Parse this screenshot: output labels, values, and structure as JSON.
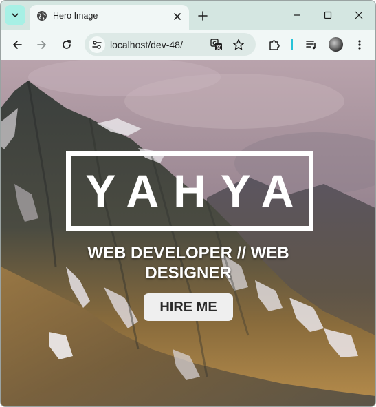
{
  "browser": {
    "tab": {
      "title": "Hero Image",
      "favicon": "globe-icon"
    },
    "address_bar": {
      "url": "localhost/dev-48/"
    },
    "icons": {
      "tab_search": "chevron-down-icon",
      "tab_close": "close-icon",
      "new_tab": "plus-icon",
      "minimize": "minimize-icon",
      "maximize": "maximize-icon",
      "close_window": "close-icon",
      "back": "back-arrow-icon",
      "forward": "forward-arrow-icon",
      "reload": "reload-icon",
      "site_info": "tune-icon",
      "translate": "translate-icon",
      "bookmark": "star-icon",
      "extensions": "puzzle-icon",
      "media": "playlist-icon",
      "profile": "avatar",
      "menu": "kebab-menu-icon"
    },
    "colors": {
      "tabstrip": "#d4e6e1",
      "toolbar": "#f1f7f6",
      "tab_search_accent": "#a7f0e5",
      "divider_accent": "#27c3d8"
    }
  },
  "hero": {
    "logo": "YAHYA",
    "subtitle": "WEB DEVELOPER // WEB DESIGNER",
    "cta_label": "HIRE ME",
    "background": "mountain-landscape-image",
    "colors": {
      "text": "#ffffff",
      "button_bg": "#efefef",
      "button_text": "#2a2a2a"
    }
  }
}
